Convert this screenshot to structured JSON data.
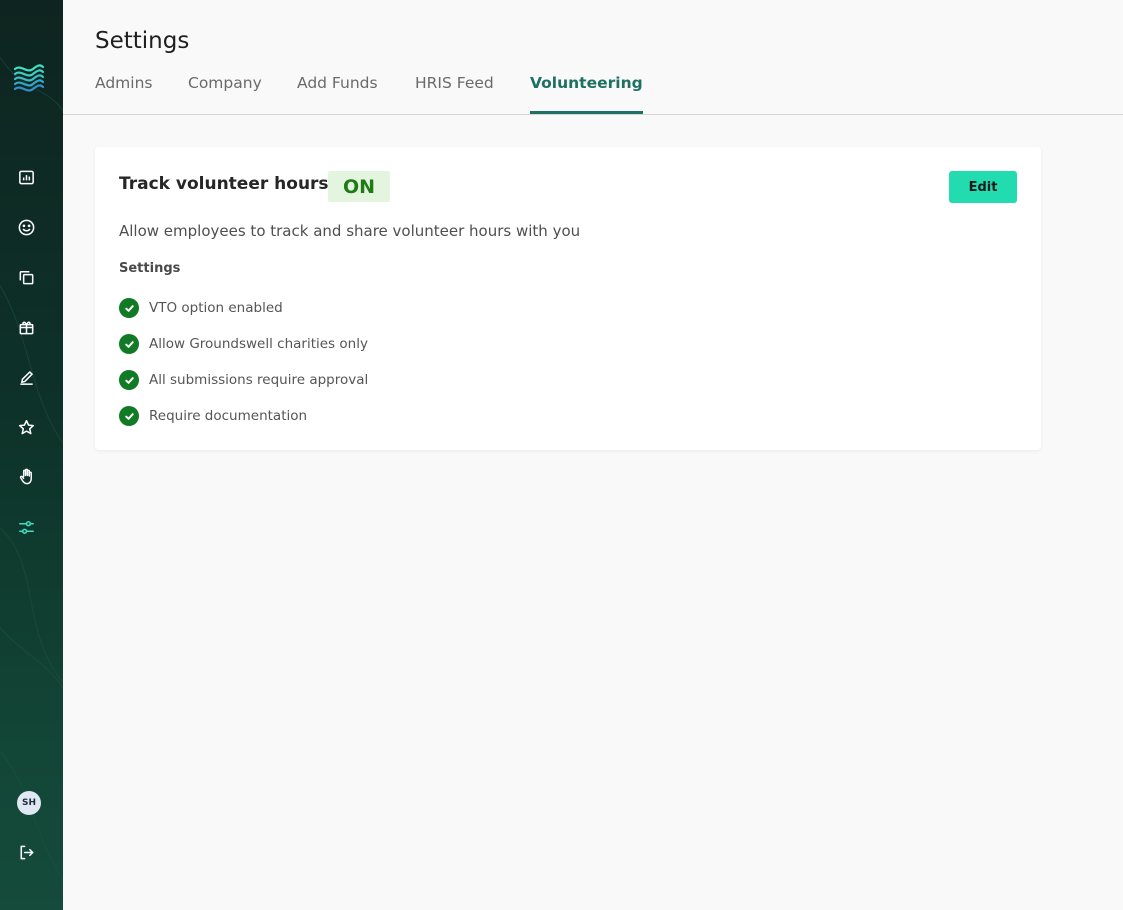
{
  "header": {
    "title": "Settings"
  },
  "tabs": [
    {
      "label": "Admins",
      "active": false
    },
    {
      "label": "Company",
      "active": false
    },
    {
      "label": "Add Funds",
      "active": false
    },
    {
      "label": "HRIS Feed",
      "active": false
    },
    {
      "label": "Volunteering",
      "active": true
    }
  ],
  "sidebar": {
    "logo": "groundswell-wave-logo",
    "items": [
      {
        "icon": "chart-icon"
      },
      {
        "icon": "smiley-icon"
      },
      {
        "icon": "copy-icon"
      },
      {
        "icon": "gift-icon"
      },
      {
        "icon": "pencil-icon"
      },
      {
        "icon": "star-icon"
      },
      {
        "icon": "hand-icon"
      },
      {
        "icon": "sliders-icon",
        "active": true
      }
    ],
    "avatar_initials": "SH",
    "logout_icon": "logout-icon"
  },
  "card": {
    "title": "Track volunteer hours",
    "status": "ON",
    "edit_label": "Edit",
    "description": "Allow employees to track and share volunteer hours with you",
    "settings_heading": "Settings",
    "settings": [
      "VTO option enabled",
      "Allow Groundswell charities only",
      "All submissions require approval",
      "Require documentation"
    ]
  },
  "colors": {
    "accent": "#1d7062",
    "button": "#22dcb0",
    "badge_bg": "#e4f5df",
    "badge_text": "#1e7b16",
    "check": "#117a25",
    "sidebar_active": "#3ee0c0"
  }
}
